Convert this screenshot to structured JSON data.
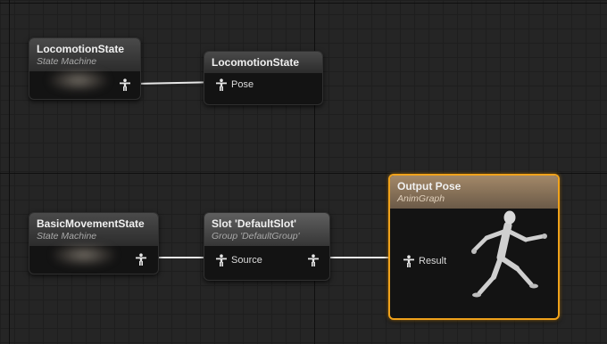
{
  "graph": {
    "nodes": {
      "locomotion_sm": {
        "title": "LocomotionState",
        "subtitle": "State Machine"
      },
      "locomotion_pose": {
        "title": "LocomotionState",
        "pin_label": "Pose"
      },
      "basic_sm": {
        "title": "BasicMovementState",
        "subtitle": "State Machine"
      },
      "slot": {
        "title": "Slot 'DefaultSlot'",
        "subtitle": "Group 'DefaultGroup'",
        "pin_label": "Source"
      },
      "output": {
        "title": "Output Pose",
        "subtitle": "AnimGraph",
        "pin_label": "Result"
      }
    }
  },
  "colors": {
    "background": "#252525",
    "selection_outline": "#f0a21b",
    "wire": "#e8e8e8"
  },
  "icons": {
    "pose_pin": "mannequin-pose-icon",
    "output_preview": "running-mannequin-icon"
  }
}
